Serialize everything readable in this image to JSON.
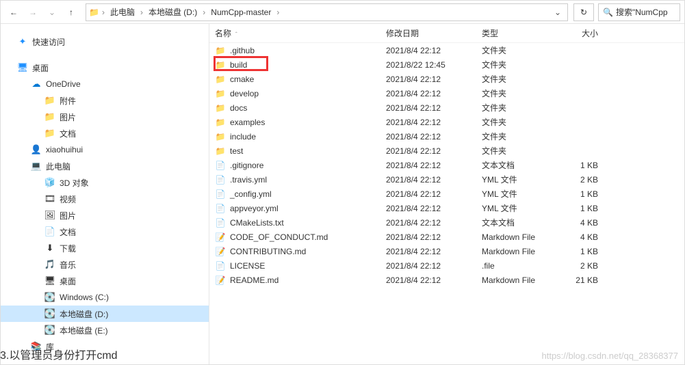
{
  "nav": {
    "back": "←",
    "fwd": "→",
    "up": "↑",
    "refresh": "↻",
    "drop": "⌄"
  },
  "breadcrumb": [
    "此电脑",
    "本地磁盘 (D:)",
    "NumCpp-master"
  ],
  "breadcrumb_sep": "›",
  "search": {
    "icon": "🔍",
    "placeholder": "搜索\"NumCpp"
  },
  "tree": {
    "quick": {
      "icon": "✦",
      "label": "快速访问",
      "color": "#1e90ff"
    },
    "desktop": {
      "icon": "🖥",
      "label": "桌面",
      "color": "#1e90ff"
    },
    "onedrive": {
      "icon": "☁",
      "label": "OneDrive",
      "color": "#0078d4"
    },
    "items1": [
      {
        "icon": "📁",
        "label": "附件"
      },
      {
        "icon": "📁",
        "label": "图片"
      },
      {
        "icon": "📁",
        "label": "文档"
      }
    ],
    "user": {
      "icon": "👤",
      "label": "xiaohuihui"
    },
    "pc": {
      "icon": "💻",
      "label": "此电脑"
    },
    "items2": [
      {
        "icon": "🧊",
        "label": "3D 对象"
      },
      {
        "icon": "🎞",
        "label": "视频"
      },
      {
        "icon": "🖼",
        "label": "图片"
      },
      {
        "icon": "📄",
        "label": "文档"
      },
      {
        "icon": "⬇",
        "label": "下载"
      },
      {
        "icon": "🎵",
        "label": "音乐"
      },
      {
        "icon": "🖥",
        "label": "桌面"
      },
      {
        "icon": "💽",
        "label": "Windows (C:)"
      },
      {
        "icon": "💽",
        "label": "本地磁盘 (D:)",
        "sel": true
      },
      {
        "icon": "💽",
        "label": "本地磁盘 (E:)"
      }
    ],
    "lib": {
      "icon": "📚",
      "label": "库"
    }
  },
  "cols": {
    "name": "名称",
    "date": "修改日期",
    "type": "类型",
    "size": "大小",
    "sort": "ˆ"
  },
  "files": [
    {
      "icon": "📁",
      "name": ".github",
      "date": "2021/8/4 22:12",
      "type": "文件夹",
      "size": ""
    },
    {
      "icon": "📁",
      "name": "build",
      "date": "2021/8/22 12:45",
      "type": "文件夹",
      "size": "",
      "hl": true
    },
    {
      "icon": "📁",
      "name": "cmake",
      "date": "2021/8/4 22:12",
      "type": "文件夹",
      "size": ""
    },
    {
      "icon": "📁",
      "name": "develop",
      "date": "2021/8/4 22:12",
      "type": "文件夹",
      "size": ""
    },
    {
      "icon": "📁",
      "name": "docs",
      "date": "2021/8/4 22:12",
      "type": "文件夹",
      "size": ""
    },
    {
      "icon": "📁",
      "name": "examples",
      "date": "2021/8/4 22:12",
      "type": "文件夹",
      "size": ""
    },
    {
      "icon": "📁",
      "name": "include",
      "date": "2021/8/4 22:12",
      "type": "文件夹",
      "size": ""
    },
    {
      "icon": "📁",
      "name": "test",
      "date": "2021/8/4 22:12",
      "type": "文件夹",
      "size": ""
    },
    {
      "icon": "📄",
      "name": ".gitignore",
      "date": "2021/8/4 22:12",
      "type": "文本文档",
      "size": "1 KB"
    },
    {
      "icon": "📄",
      "name": ".travis.yml",
      "date": "2021/8/4 22:12",
      "type": "YML 文件",
      "size": "2 KB"
    },
    {
      "icon": "📄",
      "name": "_config.yml",
      "date": "2021/8/4 22:12",
      "type": "YML 文件",
      "size": "1 KB"
    },
    {
      "icon": "📄",
      "name": "appveyor.yml",
      "date": "2021/8/4 22:12",
      "type": "YML 文件",
      "size": "1 KB"
    },
    {
      "icon": "📄",
      "name": "CMakeLists.txt",
      "date": "2021/8/4 22:12",
      "type": "文本文档",
      "size": "4 KB"
    },
    {
      "icon": "📝",
      "name": "CODE_OF_CONDUCT.md",
      "date": "2021/8/4 22:12",
      "type": "Markdown File",
      "size": "4 KB"
    },
    {
      "icon": "📝",
      "name": "CONTRIBUTING.md",
      "date": "2021/8/4 22:12",
      "type": "Markdown File",
      "size": "1 KB"
    },
    {
      "icon": "📄",
      "name": "LICENSE",
      "date": "2021/8/4 22:12",
      "type": ".file",
      "size": "2 KB"
    },
    {
      "icon": "📝",
      "name": "README.md",
      "date": "2021/8/4 22:12",
      "type": "Markdown File",
      "size": "21 KB"
    }
  ],
  "caption": "3.以管理员身份打开cmd",
  "watermark": "https://blog.csdn.net/qq_28368377"
}
